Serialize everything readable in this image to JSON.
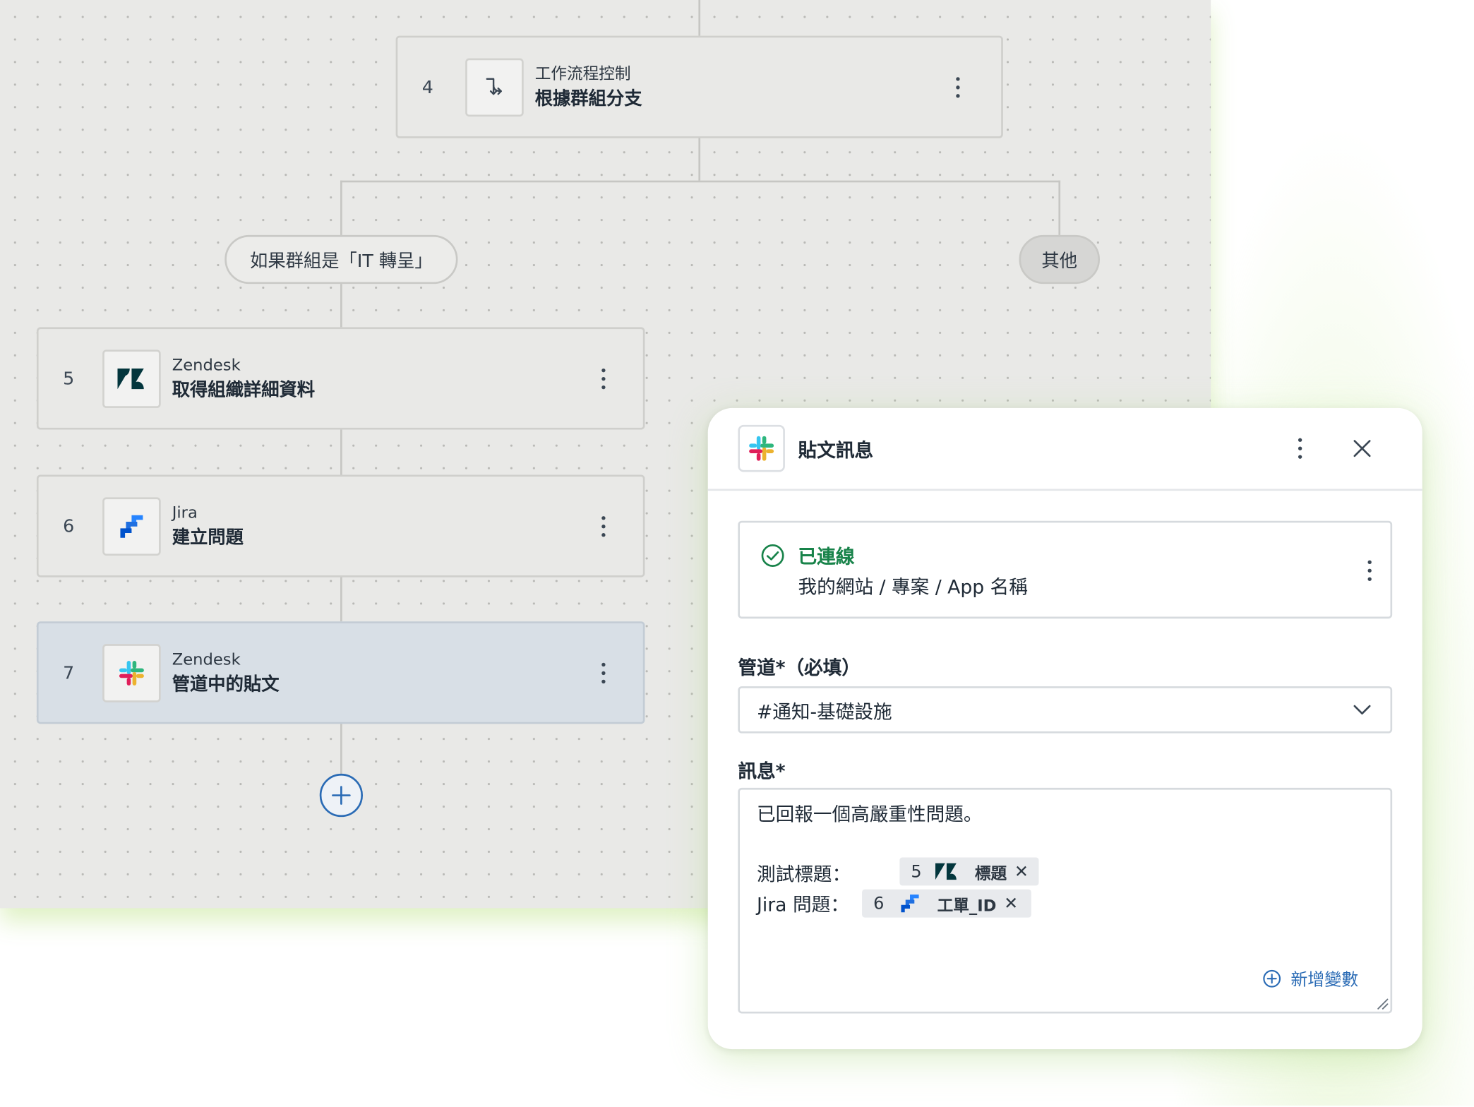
{
  "workflow": {
    "nodes": [
      {
        "step": "4",
        "app": "工作流程控制",
        "title": "根據群組分支",
        "icon": "branch-icon"
      },
      {
        "step": "5",
        "app": "Zendesk",
        "title": "取得組織詳細資料",
        "icon": "zendesk-logo-icon"
      },
      {
        "step": "6",
        "app": "Jira",
        "title": "建立問題",
        "icon": "jira-logo-icon"
      },
      {
        "step": "7",
        "app": "Zendesk",
        "title": "管道中的貼文",
        "icon": "slack-logo-icon"
      }
    ],
    "branches": {
      "if_label": "如果群組是「IT 轉呈」",
      "else_label": "其他"
    }
  },
  "panel": {
    "title": "貼文訊息",
    "connection": {
      "status": "已連線",
      "account": "我的網站 / 專案 / App 名稱"
    },
    "channel": {
      "label": "管道*（必填）",
      "value": "#通知-基礎設施"
    },
    "message": {
      "label": "訊息*",
      "line1": "已回報一個高嚴重性問題。",
      "test_title_label": "測試標題：",
      "jira_issue_label": "Jira 問題：",
      "token1": {
        "step": "5",
        "name": "標題"
      },
      "token2": {
        "step": "6",
        "name": "工單_ID"
      },
      "add_variable": "新增變數"
    }
  },
  "colors": {
    "canvas": "#e9e9e7",
    "selected_node": "#d8dfe6",
    "connected_green": "#18834a",
    "link_blue": "#2a6bb5",
    "zendesk": "#03363d",
    "jira": "#2684ff"
  }
}
